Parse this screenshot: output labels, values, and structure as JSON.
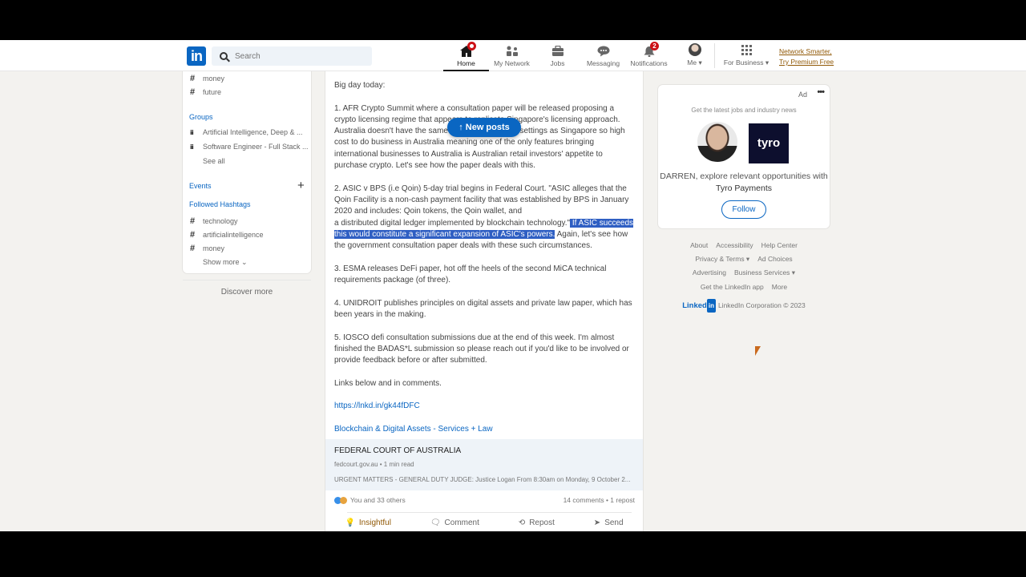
{
  "nav": {
    "search_placeholder": "Search",
    "items": [
      {
        "label": "Home",
        "icon": "home-icon",
        "active": true,
        "badge": "dot"
      },
      {
        "label": "My Network",
        "icon": "network-icon"
      },
      {
        "label": "Jobs",
        "icon": "briefcase-icon"
      },
      {
        "label": "Messaging",
        "icon": "chat-icon"
      },
      {
        "label": "Notifications",
        "icon": "bell-icon",
        "badge": "2"
      },
      {
        "label": "Me ▾",
        "icon": "avatar"
      },
      {
        "label": "For Business ▾",
        "icon": "grid-icon"
      }
    ],
    "premium_line1": "Network Smarter,",
    "premium_line2": "Try Premium Free"
  },
  "sidebar": {
    "recent_hashtags": [
      "money",
      "future"
    ],
    "groups_label": "Groups",
    "groups": [
      "Artificial Intelligence, Deep & ...",
      "Software Engineer - Full Stack ..."
    ],
    "see_all": "See all",
    "events_label": "Events",
    "followed_label": "Followed Hashtags",
    "followed": [
      "technology",
      "artificialintelligence",
      "money"
    ],
    "show_more": "Show more",
    "discover_more": "Discover more"
  },
  "post": {
    "new_posts": "↑ New posts",
    "intro": "Big day today:",
    "p1": "1. AFR Crypto Summit where a consultation paper will be released proposing a crypto licensing regime that appears to replicate Singapore's licensing approach. Australia doesn't have the same investment and tax settings as Singapore so high cost to do business in Australia meaning one of the only features bringing international businesses to Australia is Australian retail investors' appetite to purchase crypto. Let's see how the paper deals with this.",
    "p2_a": "2. ASIC v BPS (i.e Qoin) 5-day trial begins in Federal Court. \"ASIC alleges that the Qoin Facility is a non-cash payment facility that was established by BPS in January 2020 and includes: Qoin tokens, the Qoin wallet, and",
    "p2_b": "a distributed digital ledger implemented by blockchain technology.\"",
    "p2_highlight": " If ASIC succeeds this would constitute a significant expansion of ASIC's powers.",
    "p2_c": " Again, let's see how the government consultation paper deals with these such circumstances.",
    "p3": "3. ESMA releases DeFi paper, hot off the heels of the second MiCA technical requirements package (of three).",
    "p4": "4. UNIDROIT publishes principles on digital assets and private law paper, which has been years in the making.",
    "p5": "5. IOSCO defi consultation submissions due at the end of this week. I'm almost finished the BADAS*L submission so please reach out if you'd like to be involved or provide feedback before or after submitted.",
    "p6": "Links below and in comments.",
    "link": "https://lnkd.in/gk44fDFC",
    "page_link": "Blockchain & Digital Assets - Services + Law",
    "card_title": "FEDERAL COURT OF AUSTRALIA",
    "card_source": "fedcourt.gov.au • 1 min read",
    "card_desc": "URGENT MATTERS - GENERAL DUTY JUDGE: Justice Logan From 8:30am on Monday, 9 October 2...",
    "reactions": "You and 33 others",
    "counts": "14 comments • 1 repost",
    "actions": [
      "Insightful",
      "Comment",
      "Repost",
      "Send"
    ]
  },
  "ad": {
    "label": "Ad",
    "more": "•••",
    "subtitle": "Get the latest jobs and industry news",
    "logo_text": "tyro",
    "message": "DARREN, explore relevant opportunities with",
    "company": "Tyro Payments",
    "follow": "Follow"
  },
  "footer": {
    "rows": [
      [
        "About",
        "Accessibility",
        "Help Center"
      ],
      [
        "Privacy & Terms ▾",
        "Ad Choices"
      ],
      [
        "Advertising",
        "Business Services ▾"
      ],
      [
        "Get the LinkedIn app",
        "More"
      ]
    ],
    "brand_word": "Linked",
    "brand_in": "in",
    "copyright": "LinkedIn Corporation © 2023"
  },
  "colors": {
    "brand": "#0a66c2",
    "badge": "#cc1016",
    "highlight": "#2f5fc3",
    "background": "#f3f2ef"
  }
}
